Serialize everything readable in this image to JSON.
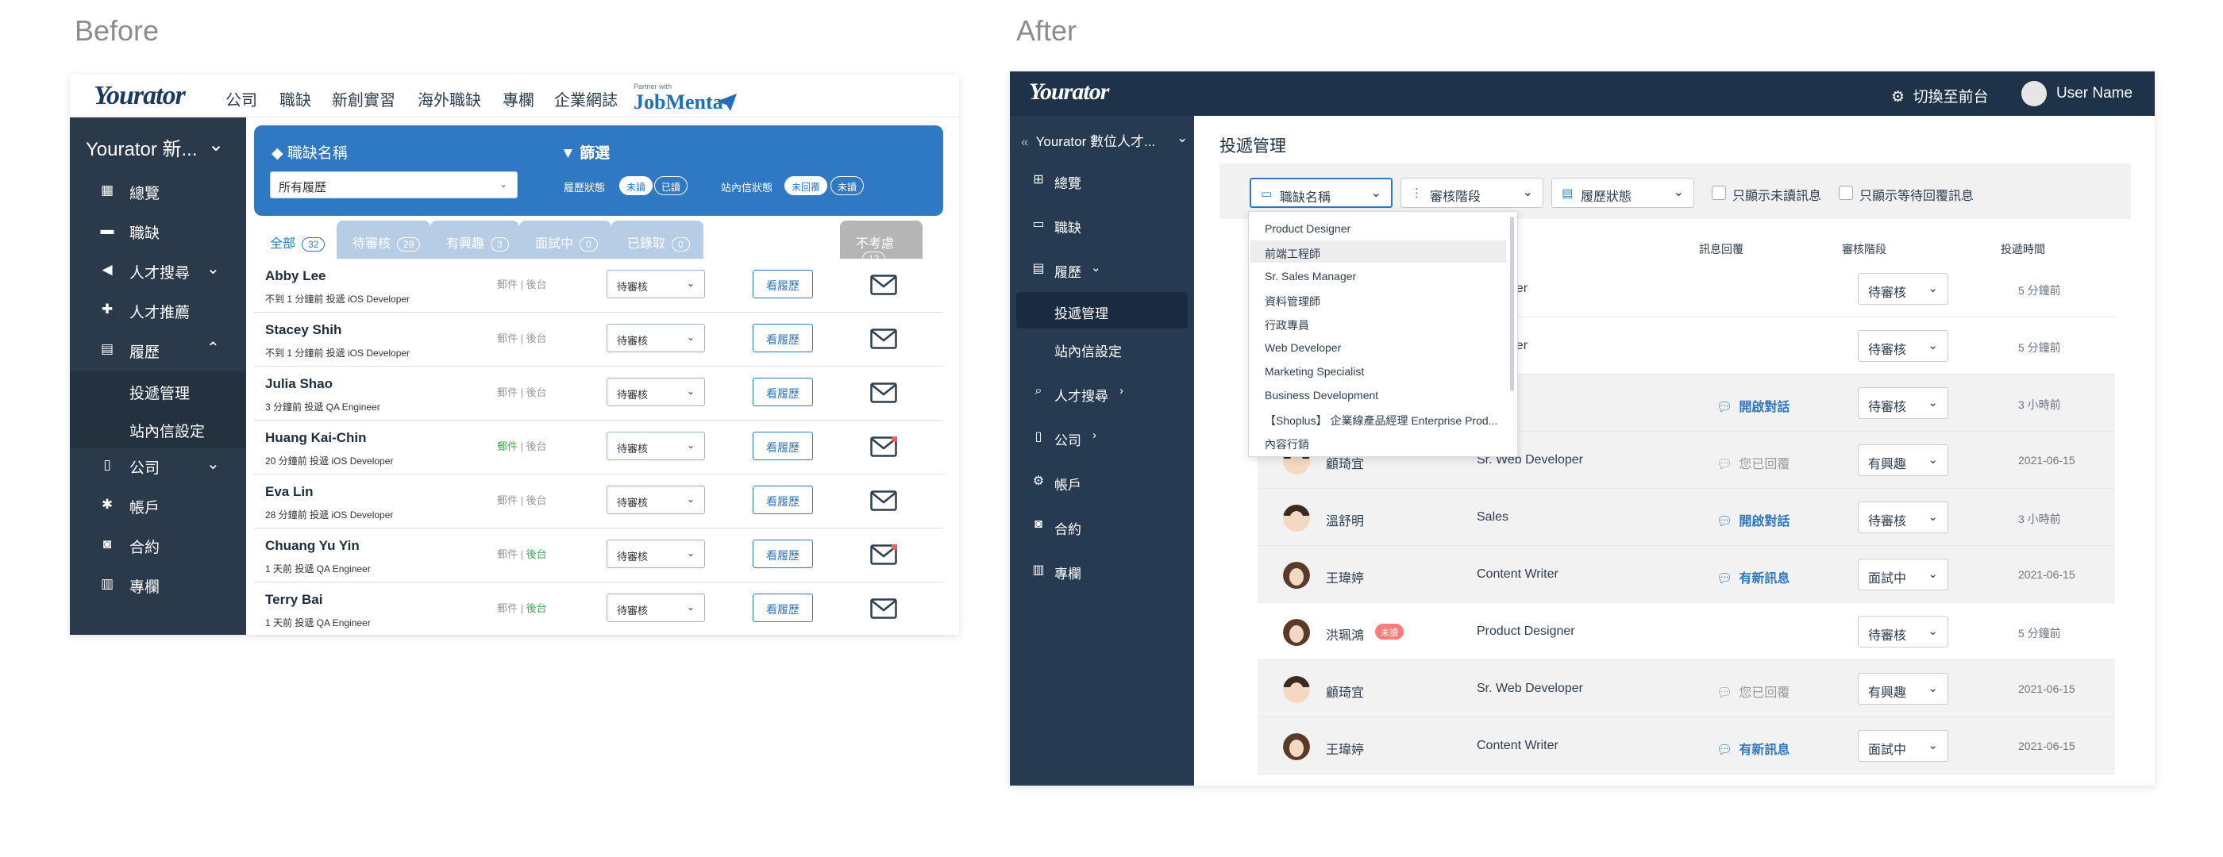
{
  "headings": {
    "before": "Before",
    "after": "After"
  },
  "before": {
    "logo": "Yourator",
    "nav": [
      "公司",
      "職缺",
      "新創實習",
      "海外職缺",
      "專欄",
      "企業網誌"
    ],
    "partner_small": "Partner with",
    "partner": "JobMenta",
    "sidebar_title": "Yourator 新...",
    "sidebar": [
      {
        "label": "總覽",
        "icon": "dashboard-icon"
      },
      {
        "label": "職缺",
        "icon": "briefcase-icon"
      },
      {
        "label": "人才搜尋",
        "icon": "megaphone-icon"
      },
      {
        "label": "人才推薦",
        "icon": "gift-icon"
      },
      {
        "label": "履歷",
        "icon": "document-icon"
      },
      {
        "label": "投遞管理"
      },
      {
        "label": "站內信設定"
      },
      {
        "label": "公司",
        "icon": "building-icon"
      },
      {
        "label": "帳戶",
        "icon": "gear-icon"
      },
      {
        "label": "合約",
        "icon": "money-icon"
      },
      {
        "label": "專欄",
        "icon": "newspaper-icon"
      }
    ],
    "filter_job_label": "職缺名稱",
    "filter_title": "篩選",
    "job_select": "所有履歷",
    "resume_status_label": "履歷狀態",
    "resume_status_pills": [
      "未讀",
      "已讀"
    ],
    "message_status_label": "站內信狀態",
    "message_status_pills": [
      "未回覆",
      "未讀"
    ],
    "tabs": [
      {
        "label": "全部",
        "count": "32"
      },
      {
        "label": "待審核",
        "count": "29"
      },
      {
        "label": "有興趣",
        "count": "3"
      },
      {
        "label": "面試中",
        "count": "0"
      },
      {
        "label": "已錄取",
        "count": "0"
      },
      {
        "label": "不考慮",
        "count": "12"
      }
    ],
    "link_mail": "郵件",
    "link_sep": "|",
    "link_backend": "後台",
    "view_button": "看履歷",
    "rows": [
      {
        "name": "Abby Lee",
        "meta": "不到 1 分鐘前 投遞  iOS Developer",
        "status": "待審核"
      },
      {
        "name": "Stacey Shih",
        "meta": "不到 1 分鐘前 投遞  iOS Developer",
        "status": "待審核"
      },
      {
        "name": "Julia Shao",
        "meta": "3 分鐘前 投遞  QA Engineer",
        "status": "待審核"
      },
      {
        "name": "Huang Kai-Chin",
        "meta": "20 分鐘前 投遞  iOS Developer",
        "status": "待審核"
      },
      {
        "name": "Eva Lin",
        "meta": "28 分鐘前 投遞  iOS Developer",
        "status": "待審核"
      },
      {
        "name": "Chuang Yu Yin",
        "meta": "1 天前 投遞  QA Engineer",
        "status": "待審核"
      },
      {
        "name": "Terry Bai",
        "meta": "1 天前 投遞  QA Engineer",
        "status": "待審核"
      }
    ]
  },
  "after": {
    "logo": "Yourator",
    "switch_label": "切換至前台",
    "user_name": "User Name",
    "sidebar_title": "Yourator 數位人才...",
    "sidebar": [
      {
        "label": "總覽"
      },
      {
        "label": "職缺"
      },
      {
        "label": "履歷"
      },
      {
        "label": "投遞管理"
      },
      {
        "label": "站內信設定"
      },
      {
        "label": "人才搜尋"
      },
      {
        "label": "公司"
      },
      {
        "label": "帳戶"
      },
      {
        "label": "合約"
      },
      {
        "label": "專欄"
      }
    ],
    "page_title": "投遞管理",
    "filters": [
      "職缺名稱",
      "審核階段",
      "履歷狀態"
    ],
    "checkboxes": [
      "只顯示未讀訊息",
      "只顯示等待回覆訊息"
    ],
    "columns": [
      "訊息回覆",
      "審核階段",
      "投遞時間"
    ],
    "dropdown_options": [
      "Product Designer",
      "前端工程師",
      "Sr. Sales Manager",
      "資料管理師",
      "行政專員",
      "Web Developer",
      "Marketing Specialist",
      "Business Development",
      "【Shoplus】 企業線產品經理 Enterprise Prod...",
      "內容行銷"
    ],
    "rows": [
      {
        "name": "",
        "position": "Designer",
        "message": "",
        "stage": "待審核",
        "time": "5 分鐘前"
      },
      {
        "name": "",
        "position": "Designer",
        "message": "",
        "stage": "待審核",
        "time": "5 分鐘前"
      },
      {
        "name": "",
        "position": "",
        "message": "開啟對話",
        "stage": "待審核",
        "time": "3 小時前"
      },
      {
        "name": "顧琦宜",
        "position": "Sr. Web Developer",
        "message": "您已回覆",
        "stage": "有興趣",
        "time": "2021-06-15"
      },
      {
        "name": "溫舒明",
        "position": "Sales",
        "message": "開啟對話",
        "stage": "待審核",
        "time": "3 小時前"
      },
      {
        "name": "王瑋婷",
        "position": "Content Writer",
        "message": "有新訊息",
        "stage": "面試中",
        "time": "2021-06-15"
      },
      {
        "name": "洪珮鴻",
        "badge": "未讀",
        "position": "Product Designer",
        "message": "",
        "stage": "待審核",
        "time": "5 分鐘前"
      },
      {
        "name": "顧琦宜",
        "position": "Sr. Web Developer",
        "message": "您已回覆",
        "stage": "有興趣",
        "time": "2021-06-15"
      },
      {
        "name": "王瑋婷",
        "position": "Content Writer",
        "message": "有新訊息",
        "stage": "面試中",
        "time": "2021-06-15"
      }
    ]
  },
  "colors": {
    "navy": "#1e3249",
    "blue": "#2f78c4",
    "badge": "#ff7a7a"
  }
}
